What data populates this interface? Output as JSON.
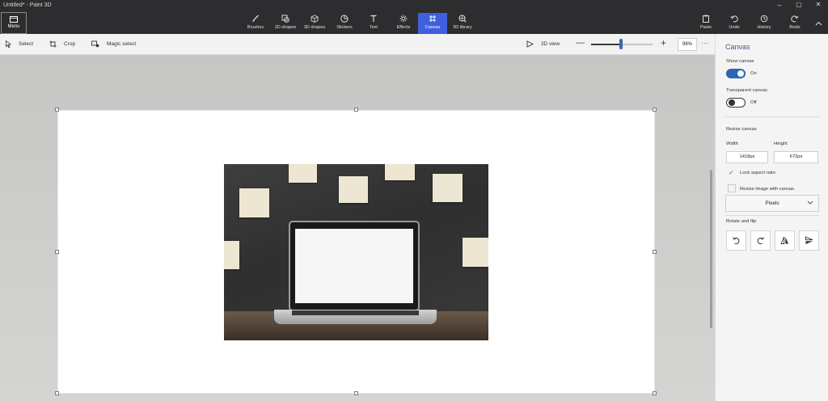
{
  "window": {
    "title": "Untitled* - Paint 3D",
    "menu_label": "Menu",
    "minimize": "–",
    "maximize": "▢",
    "close": "✕"
  },
  "ribbon": {
    "tools": [
      {
        "label": "Brushes",
        "icon": "brush-icon"
      },
      {
        "label": "2D shapes",
        "icon": "2d-shapes-icon"
      },
      {
        "label": "3D shapes",
        "icon": "3d-shapes-icon"
      },
      {
        "label": "Stickers",
        "icon": "stickers-icon"
      },
      {
        "label": "Text",
        "icon": "text-icon"
      },
      {
        "label": "Effects",
        "icon": "effects-icon"
      },
      {
        "label": "Canvas",
        "icon": "canvas-icon",
        "active": true
      },
      {
        "label": "3D library",
        "icon": "3d-library-icon"
      }
    ],
    "actions": [
      {
        "label": "Paste",
        "icon": "paste-icon"
      },
      {
        "label": "Undo",
        "icon": "undo-icon"
      },
      {
        "label": "History",
        "icon": "history-icon"
      },
      {
        "label": "Redo",
        "icon": "redo-icon"
      }
    ],
    "accent_color": "#3f5fdc"
  },
  "toolbar": {
    "select_label": "Select",
    "crop_label": "Crop",
    "magic_select_label": "Magic select",
    "view_3d_label": "3D view",
    "zoom_minus": "—",
    "zoom_plus": "+",
    "zoom_value": "98%",
    "zoom_level": 0.46,
    "more": "···"
  },
  "panel": {
    "title": "Canvas",
    "show_canvas_label": "Show canvas",
    "show_canvas_state": "On",
    "transparent_canvas_label": "Transparent canvas",
    "transparent_canvas_state": "Off",
    "resize_canvas_label": "Resize canvas",
    "width_label": "Width",
    "height_label": "Height",
    "width_value": "1418px",
    "height_value": "672px",
    "lock_aspect_label": "Lock aspect ratio",
    "lock_aspect_checked": true,
    "resize_image_label": "Resize image with canvas",
    "resize_image_checked": false,
    "units_value": "Pixels",
    "rotate_flip_label": "Rotate and flip",
    "toggle_on_color": "#2c66b3"
  }
}
